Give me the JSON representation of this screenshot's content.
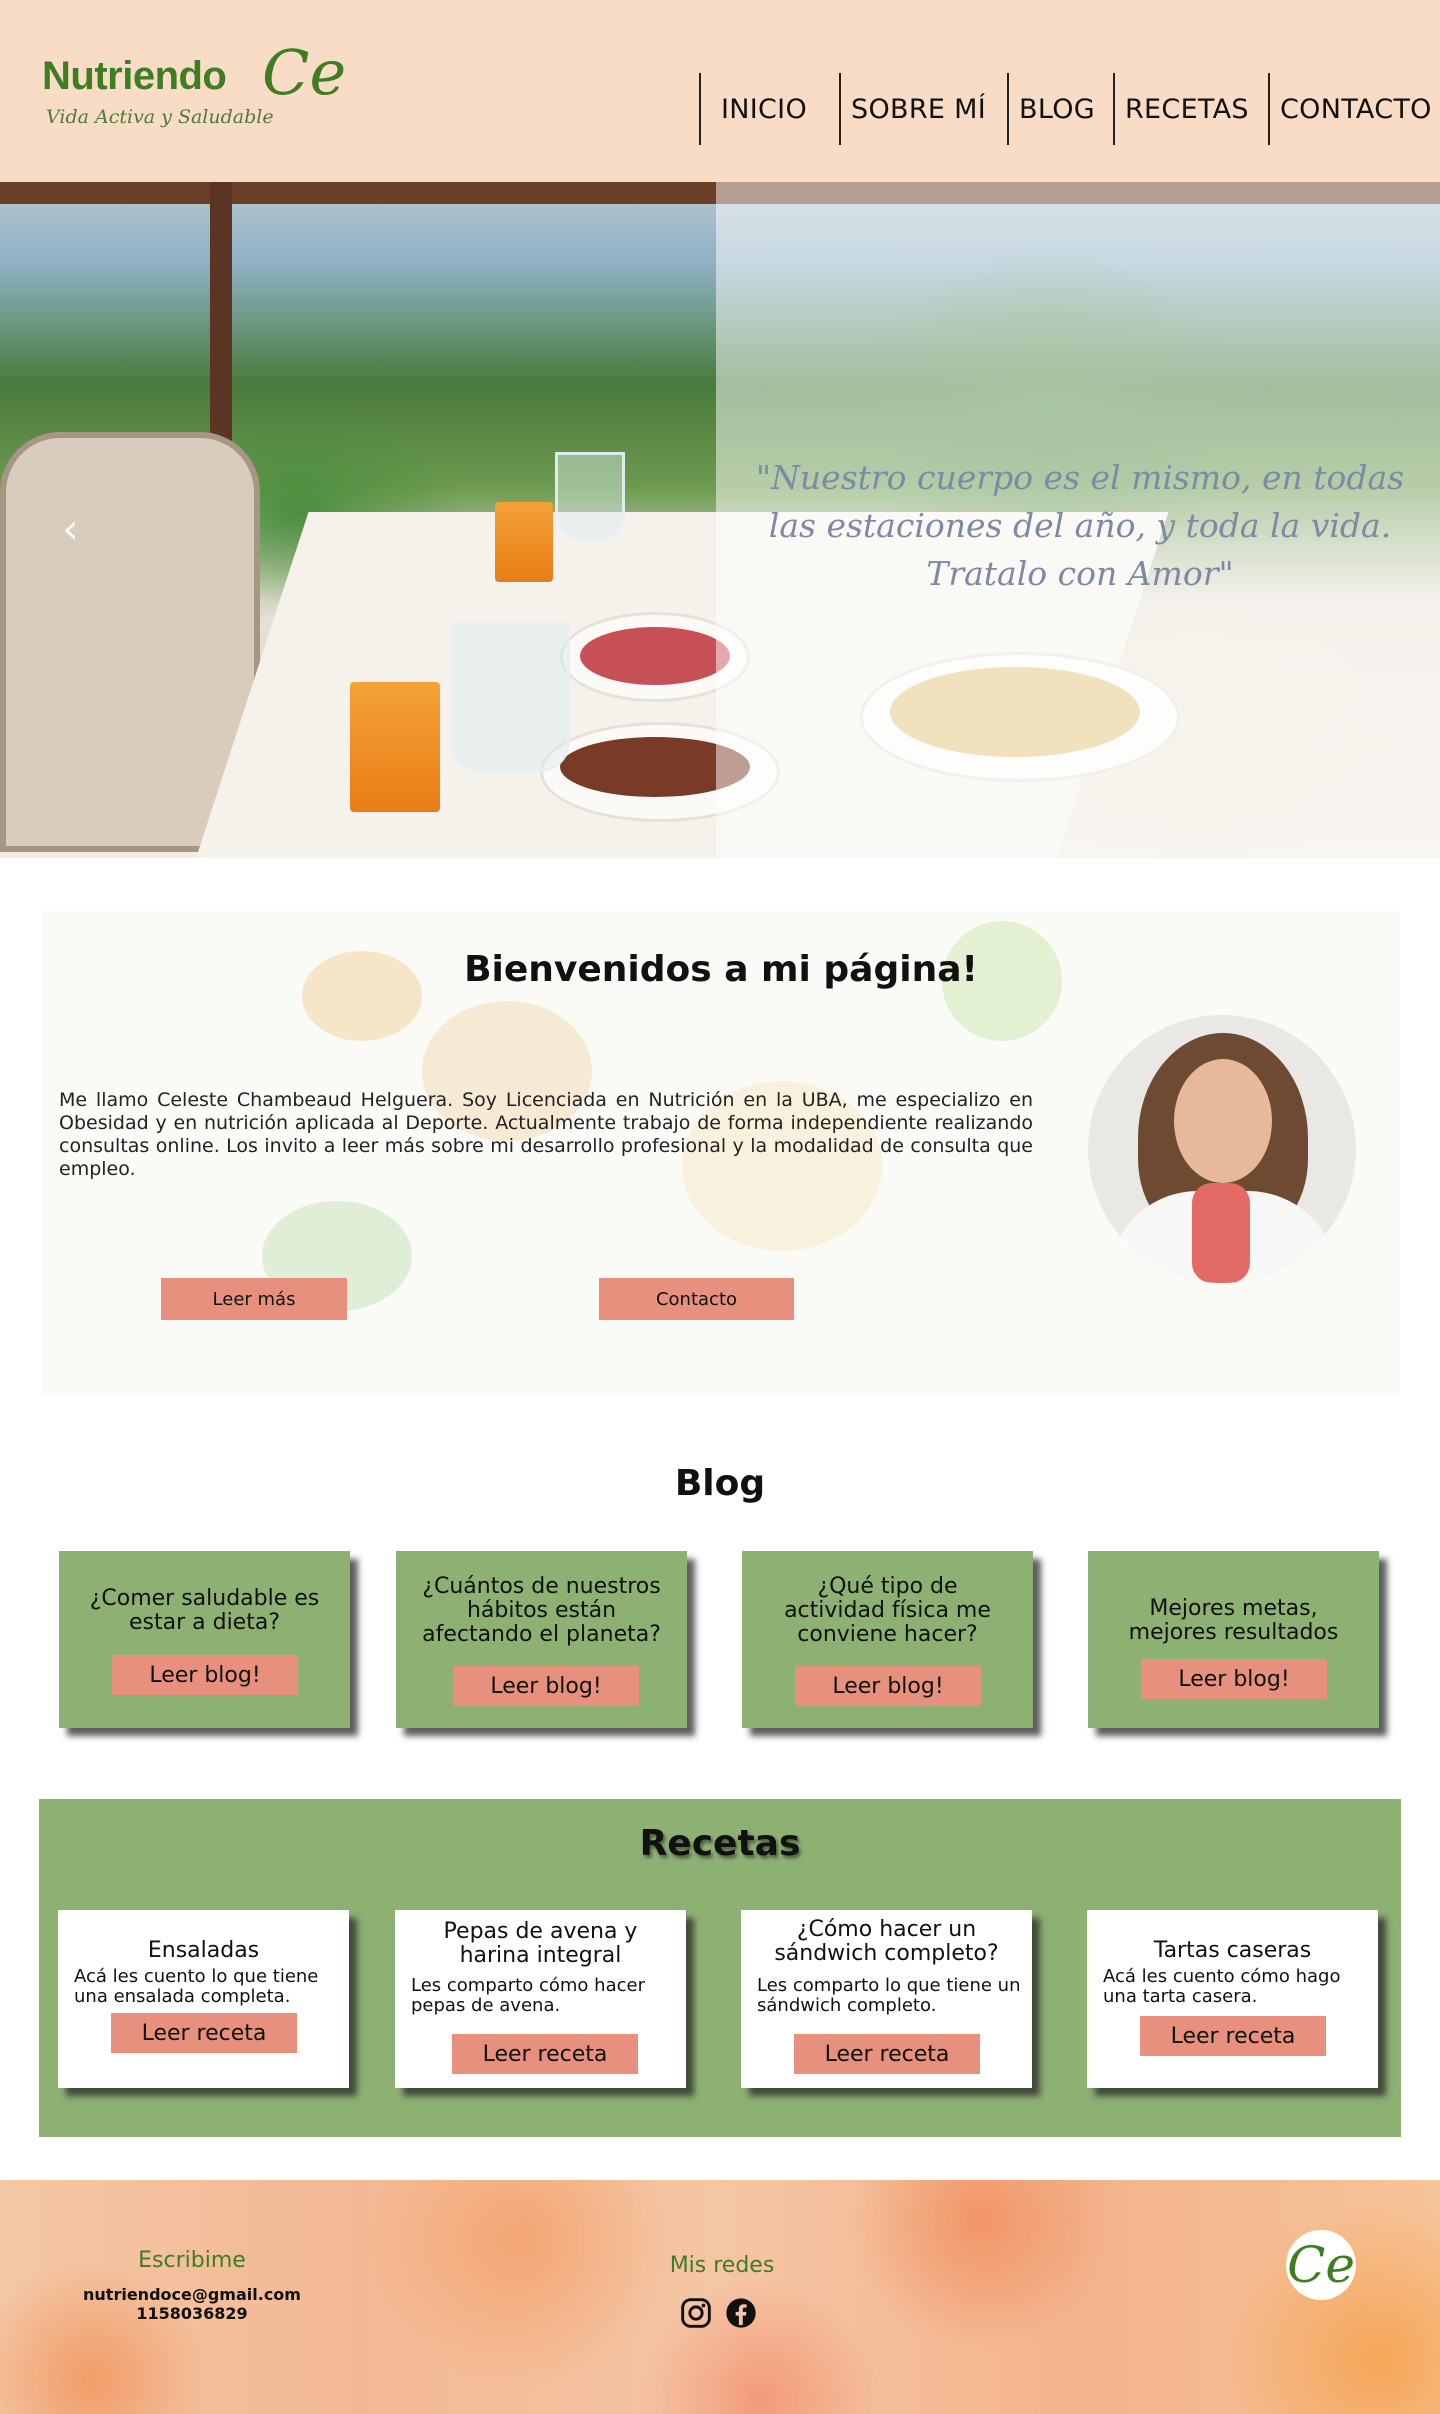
{
  "header": {
    "logo_name": "Nutriendo",
    "logo_ce": "Ce",
    "logo_tagline": "Vida Activa y Saludable",
    "nav": [
      "INICIO",
      "SOBRE MÍ",
      "BLOG",
      "RECETAS",
      "CONTACTO"
    ]
  },
  "hero": {
    "quote": "\"Nuestro cuerpo es el mismo, en todas las estaciones del año, y toda la vida. Tratalo con Amor\"",
    "prev_arrow": "‹"
  },
  "welcome": {
    "title": "Bienvenidos a mi página!",
    "text": "Me llamo Celeste Chambeaud Helguera. Soy Licenciada en Nutrición en la UBA, me especializo en Obesidad y en nutrición aplicada al Deporte. Actualmente trabajo de forma independiente realizando consultas online. Los invito a leer más sobre mi desarrollo profesional y la modalidad de consulta que empleo.",
    "btn_more": "Leer más",
    "btn_contact": "Contacto"
  },
  "blog": {
    "title": "Blog",
    "cards": [
      {
        "title": "¿Comer saludable es estar a dieta?",
        "button": "Leer blog!"
      },
      {
        "title": "¿Cuántos de nuestros hábitos están afectando el planeta?",
        "button": "Leer blog!"
      },
      {
        "title": "¿Qué tipo de actividad física me conviene hacer?",
        "button": "Leer blog!"
      },
      {
        "title": "Mejores metas, mejores resultados",
        "button": "Leer blog!"
      }
    ]
  },
  "recipes": {
    "title": "Recetas",
    "cards": [
      {
        "title": "Ensaladas",
        "desc": "Acá les cuento lo que tiene una ensalada completa.",
        "button": "Leer receta"
      },
      {
        "title": "Pepas de avena y harina integral",
        "desc": "Les comparto cómo hacer pepas de avena.",
        "button": "Leer receta"
      },
      {
        "title": "¿Cómo hacer un sándwich completo?",
        "desc": "Les comparto lo que tiene un sándwich completo.",
        "button": "Leer receta"
      },
      {
        "title": "Tartas caseras",
        "desc": "Acá les cuento cómo hago una tarta casera.",
        "button": "Leer receta"
      }
    ]
  },
  "footer": {
    "write_heading": "Escribime",
    "email": "nutriendoce@gmail.com",
    "phone": "1158036829",
    "social_heading": "Mis redes",
    "logo": "Ce"
  },
  "colors": {
    "header_bg": "#f8dcc6",
    "brand_green": "#3f7d22",
    "card_green": "#8db073",
    "button_salmon": "#e6907d"
  },
  "icons": [
    "instagram-icon",
    "facebook-icon",
    "chevron-left-icon"
  ]
}
